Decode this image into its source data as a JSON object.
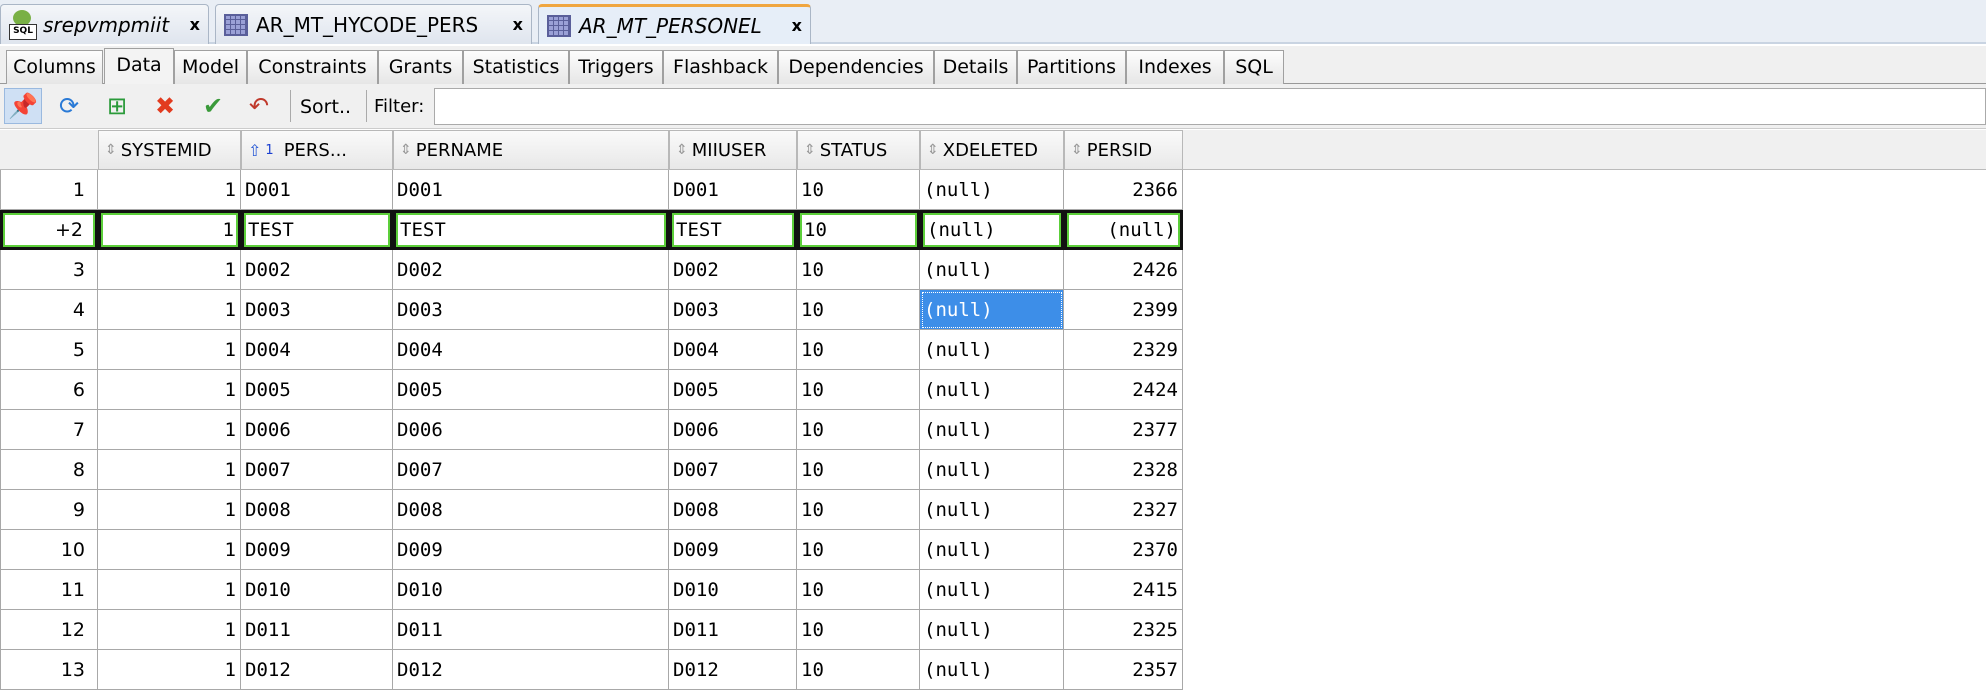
{
  "doc_tabs": [
    {
      "label": "srepvmpmiit",
      "icon": "sql-worksheet-icon",
      "italic": true,
      "close": "x"
    },
    {
      "label": "AR_MT_HYCODE_PERS",
      "icon": "table-icon",
      "italic": false,
      "close": "x"
    },
    {
      "label": "AR_MT_PERSONEL",
      "icon": "table-icon",
      "italic": true,
      "close": "x",
      "active": true
    }
  ],
  "sub_tabs": [
    "Columns",
    "Data",
    "Model",
    "Constraints",
    "Grants",
    "Statistics",
    "Triggers",
    "Flashback",
    "Dependencies",
    "Details",
    "Partitions",
    "Indexes",
    "SQL"
  ],
  "toolbar": {
    "sort_label": "Sort..",
    "filter_label": "Filter:",
    "filter_value": ""
  },
  "columns": [
    "SYSTEMID",
    "PERS...",
    "PERNAME",
    "MIIUSER",
    "STATUS",
    "XDELETED",
    "PERSID"
  ],
  "sort_indicator": "1",
  "rows": [
    [
      "1",
      "1",
      "D001",
      "D001",
      "D001",
      "10",
      "(null)",
      "2366"
    ],
    [
      "+2",
      "1",
      "TEST",
      "TEST",
      "TEST",
      "10",
      "(null)",
      "(null)"
    ],
    [
      "3",
      "1",
      "D002",
      "D002",
      "D002",
      "10",
      "(null)",
      "2426"
    ],
    [
      "4",
      "1",
      "D003",
      "D003",
      "D003",
      "10",
      "(null)",
      "2399"
    ],
    [
      "5",
      "1",
      "D004",
      "D004",
      "D004",
      "10",
      "(null)",
      "2329"
    ],
    [
      "6",
      "1",
      "D005",
      "D005",
      "D005",
      "10",
      "(null)",
      "2424"
    ],
    [
      "7",
      "1",
      "D006",
      "D006",
      "D006",
      "10",
      "(null)",
      "2377"
    ],
    [
      "8",
      "1",
      "D007",
      "D007",
      "D007",
      "10",
      "(null)",
      "2328"
    ],
    [
      "9",
      "1",
      "D008",
      "D008",
      "D008",
      "10",
      "(null)",
      "2327"
    ],
    [
      "10",
      "1",
      "D009",
      "D009",
      "D009",
      "10",
      "(null)",
      "2370"
    ],
    [
      "11",
      "1",
      "D010",
      "D010",
      "D010",
      "10",
      "(null)",
      "2415"
    ],
    [
      "12",
      "1",
      "D011",
      "D011",
      "D011",
      "10",
      "(null)",
      "2325"
    ],
    [
      "13",
      "1",
      "D012",
      "D012",
      "D012",
      "10",
      "(null)",
      "2357"
    ]
  ]
}
